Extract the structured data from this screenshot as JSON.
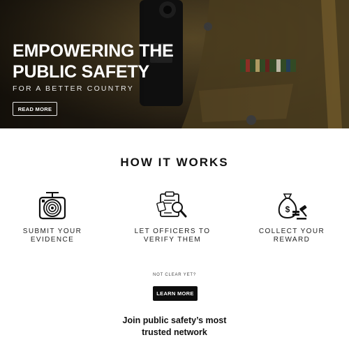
{
  "hero": {
    "title_line1": "EMPOWERING THE",
    "title_line2": "PUBLIC SAFETY",
    "subtitle": "FOR A BETTER COUNTRY",
    "button_label": "READ MORE"
  },
  "how_it_works": {
    "title": "HOW IT WORKS",
    "steps": [
      {
        "icon": "camera-lens-icon",
        "line1": "SUBMIT YOUR",
        "line2": "EVIDENCE"
      },
      {
        "icon": "clipboard-magnifier-icon",
        "line1": "LET OFFICERS TO",
        "line2": "VERIFY THEM"
      },
      {
        "icon": "money-bag-gavel-icon",
        "line1": "COLLECT YOUR",
        "line2": "REWARD"
      }
    ]
  },
  "cta": {
    "prompt": "NOT CLEAR YET?",
    "button_label": "LEARN MORE",
    "join_line1": "Join public safety’s most",
    "join_line2": "trusted network"
  },
  "colors": {
    "hero_overlay": "#2a2418",
    "button_dark": "#0d0d0d",
    "text_dark": "#111111"
  }
}
